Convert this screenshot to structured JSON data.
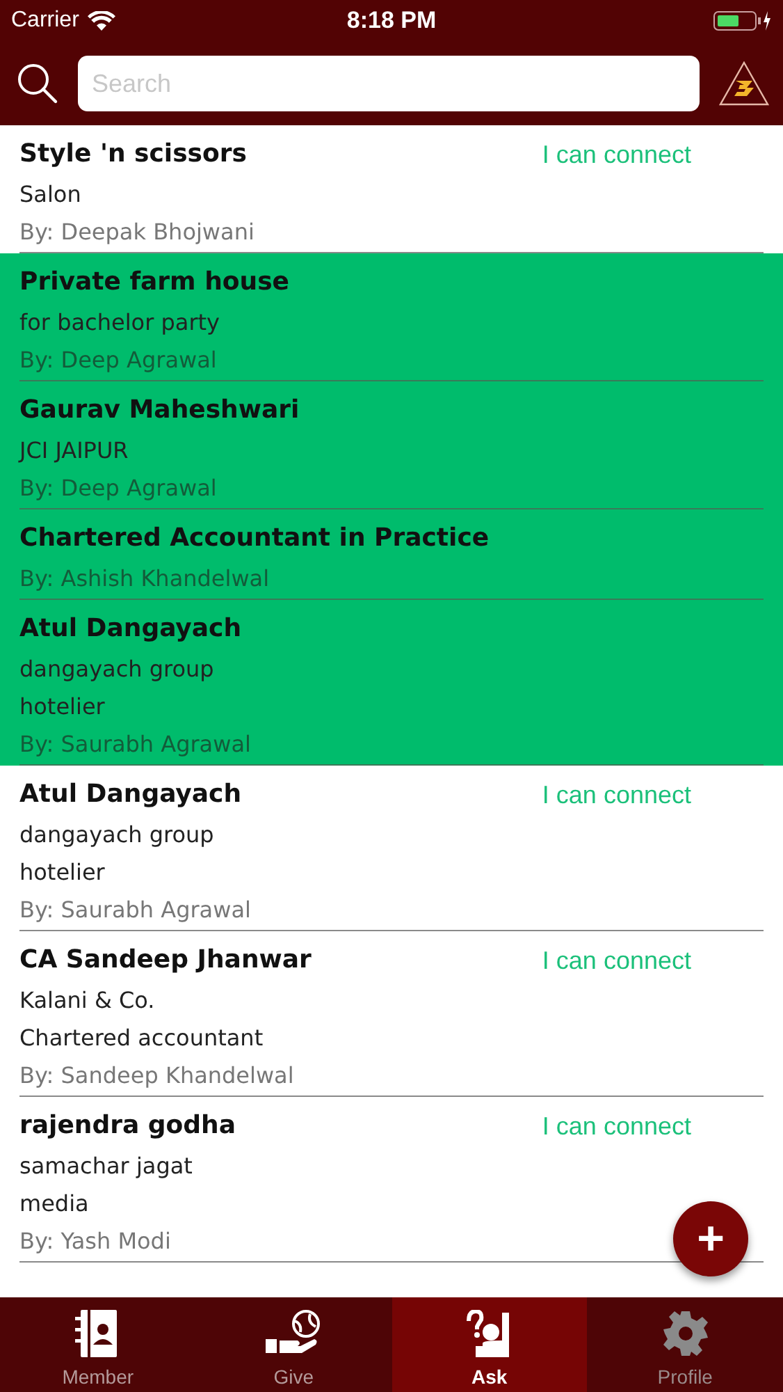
{
  "status_bar": {
    "carrier": "Carrier",
    "time": "8:18 PM"
  },
  "search": {
    "placeholder": "Search"
  },
  "rows": [
    {
      "title": "Style 'n scissors",
      "lines": [
        "Salon"
      ],
      "by": "By: Deepak Bhojwani",
      "action": "I can connect",
      "highlighted": false
    },
    {
      "title": "Private farm house",
      "lines": [
        "for bachelor party"
      ],
      "by": "By: Deep Agrawal",
      "highlighted": true
    },
    {
      "title": "Gaurav Maheshwari",
      "lines": [
        "JCI JAIPUR"
      ],
      "by": "By: Deep Agrawal",
      "highlighted": true
    },
    {
      "title": "Chartered Accountant in Practice",
      "lines": [],
      "by": "By: Ashish Khandelwal",
      "highlighted": true
    },
    {
      "title": "Atul Dangayach",
      "lines": [
        "dangayach group",
        "hotelier"
      ],
      "by": "By: Saurabh Agrawal",
      "highlighted": true
    },
    {
      "title": "Atul Dangayach",
      "lines": [
        "dangayach group",
        "hotelier"
      ],
      "by": "By: Saurabh Agrawal",
      "action": "I can connect",
      "highlighted": false
    },
    {
      "title": "CA Sandeep Jhanwar",
      "lines": [
        "Kalani & Co.",
        "Chartered accountant"
      ],
      "by": "By: Sandeep Khandelwal",
      "action": "I can connect",
      "highlighted": false
    },
    {
      "title": "rajendra godha",
      "lines": [
        "samachar jagat",
        "media"
      ],
      "by": "By: Yash Modi",
      "action": "I can connect",
      "highlighted": false
    }
  ],
  "fab": {
    "label": "+"
  },
  "tabs": [
    {
      "label": "Member",
      "kind": "member",
      "selected": false
    },
    {
      "label": "Give",
      "kind": "give",
      "selected": false
    },
    {
      "label": "Ask",
      "kind": "ask",
      "selected": true
    },
    {
      "label": "Profile",
      "kind": "profile",
      "selected": false
    }
  ]
}
